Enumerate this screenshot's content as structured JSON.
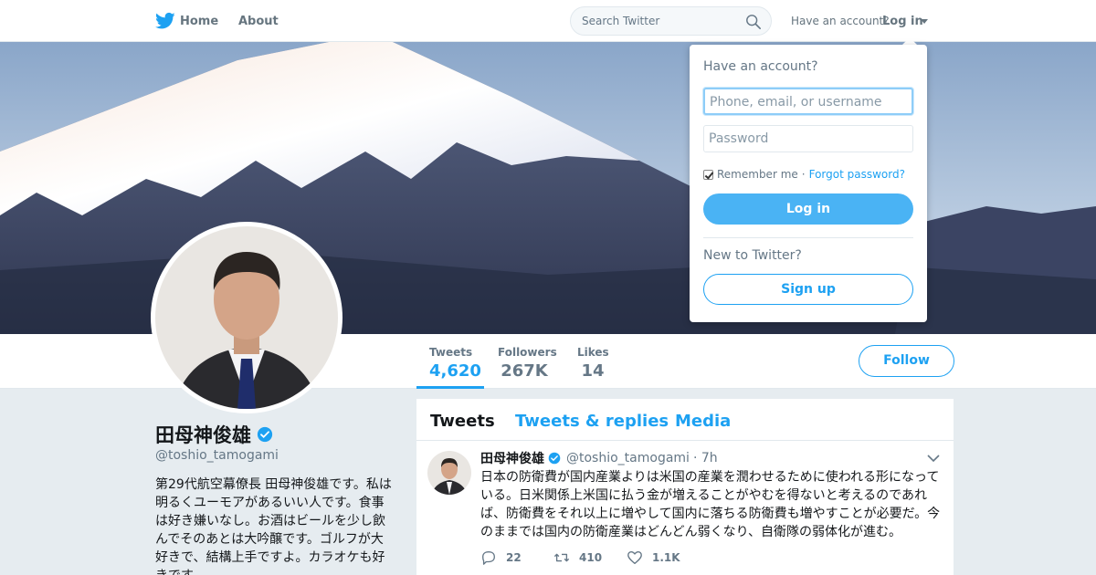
{
  "nav": {
    "home_label": "Home",
    "about_label": "About",
    "search_placeholder": "Search Twitter",
    "have_account": "Have an account?",
    "login_label": "Log in",
    "brand_color": "#1da1f2"
  },
  "profile": {
    "name": "田母神俊雄",
    "handle": "@toshio_tamogami",
    "verified": true,
    "bio": "第29代航空幕僚長 田母神俊雄です。私は明るくユーモアがあるいい人です。食事は好き嫌いなし。お酒はビールを少し飲んでそのあとは大吟醸です。ゴルフが大好きで、結構上手ですよ。カラオケも好きです。"
  },
  "stats": [
    {
      "label": "Tweets",
      "value": "4,620",
      "active": true
    },
    {
      "label": "Followers",
      "value": "267K",
      "active": false
    },
    {
      "label": "Likes",
      "value": "14",
      "active": false
    }
  ],
  "follow_label": "Follow",
  "timeline": {
    "tabs": [
      {
        "label": "Tweets",
        "active": true
      },
      {
        "label": "Tweets & replies",
        "active": false
      },
      {
        "label": "Media",
        "active": false
      }
    ],
    "tweet": {
      "name": "田母神俊雄",
      "handle": "@toshio_tamogami",
      "time": "· 7h",
      "text": "日本の防衛費が国内産業よりは米国の産業を潤わせるために使われる形になっている。日米関係上米国に払う金が増えることがやむを得ないと考えるのであれば、防衛費をそれ以上に増やして国内に落ちる防衛費も増やすことが必要だ。今のままでは国内の防衛産業はどんどん弱くなり、自衛隊の弱体化が進む。",
      "replies": "22",
      "retweets": "410",
      "likes": "1.1K"
    }
  },
  "login_dropdown": {
    "title": "Have an account?",
    "username_placeholder": "Phone, email, or username",
    "password_placeholder": "Password",
    "remember_label": "Remember me",
    "separator": "·",
    "forgot_label": "Forgot password?",
    "login_button": "Log in",
    "new_prompt": "New to Twitter?",
    "signup_button": "Sign up"
  }
}
